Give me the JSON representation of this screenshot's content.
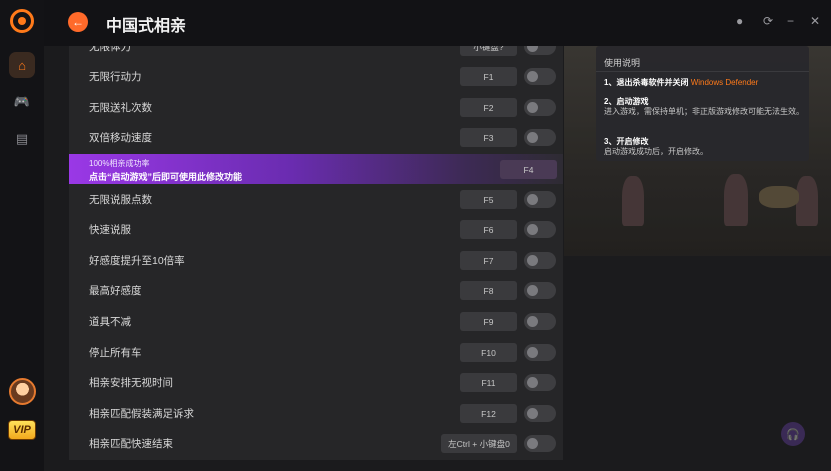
{
  "header": {
    "title": "中国式相亲",
    "back_icon": "←",
    "settings_icon": "●",
    "history_icon": "⟳",
    "minimize_icon": "−",
    "close_icon": "✕"
  },
  "rail": {
    "home_icon": "⌂",
    "games_icon": "🎮",
    "store_icon": "▤",
    "vip_label": "VIP"
  },
  "cheats": [
    {
      "label": "无限体力",
      "key": "小键盘?"
    },
    {
      "label": "无限行动力",
      "key": "F1"
    },
    {
      "label": "无限送礼次数",
      "key": "F2"
    },
    {
      "label": "双倍移动速度",
      "key": "F3"
    },
    {
      "label": "无限说服点数",
      "key": "F5"
    },
    {
      "label": "快速说服",
      "key": "F6"
    },
    {
      "label": "好感度提升至10倍率",
      "key": "F7"
    },
    {
      "label": "最高好感度",
      "key": "F8"
    },
    {
      "label": "道具不减",
      "key": "F9"
    },
    {
      "label": "停止所有车",
      "key": "F10"
    },
    {
      "label": "相亲安排无视时间",
      "key": "F11"
    },
    {
      "label": "相亲匹配假装满足诉求",
      "key": "F12"
    },
    {
      "label": "相亲匹配快速结束",
      "key": "左Ctrl + 小键盘0"
    }
  ],
  "promo": {
    "line1": "100%相亲成功率",
    "line2": "点击“启动游戏”后即可使用此修改功能",
    "key": "F4"
  },
  "info": {
    "title": "使用说明",
    "step1_head": "1、退出杀毒软件并关闭",
    "step1_accent": "Windows Defender",
    "step2_head": "2、启动游戏",
    "step2_text": "进入游戏，需保持单机；非正版游戏修改可能无法生效。",
    "step3_head": "3、开启修改",
    "step3_text": "启动游戏成功后，开启修改。"
  },
  "support": {
    "headset_icon": "🎧"
  }
}
